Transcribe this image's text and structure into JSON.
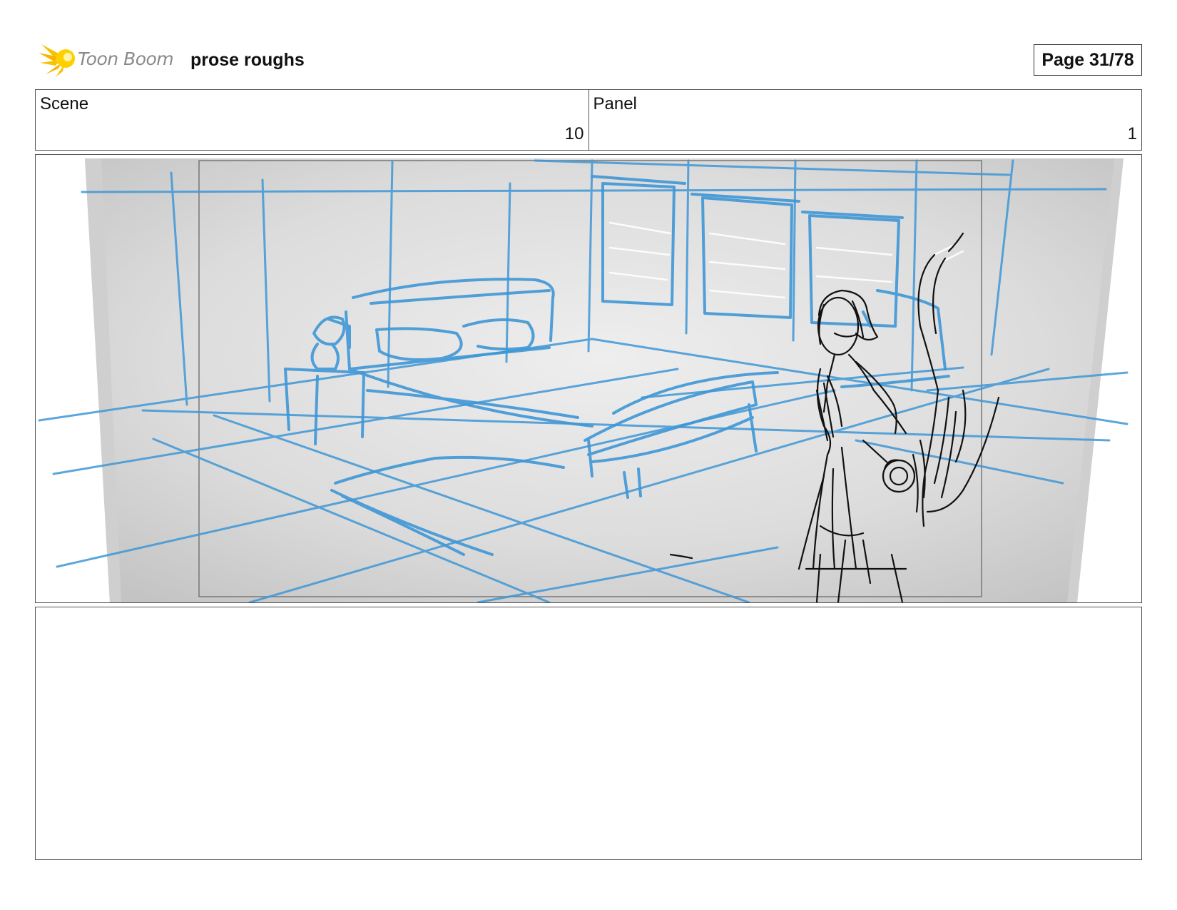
{
  "header": {
    "logo_text": "Toon Boom",
    "project_title": "prose roughs",
    "page_label": "Page 31/78"
  },
  "info": {
    "scene_label": "Scene",
    "scene_value": "10",
    "panel_label": "Panel",
    "panel_value": "1"
  },
  "colors": {
    "sketch_blue": "#3f97d6",
    "sketch_black": "#111111",
    "logo_yellow": "#f5c400"
  },
  "icons": {
    "logo": "toon-boom-star-icon"
  }
}
